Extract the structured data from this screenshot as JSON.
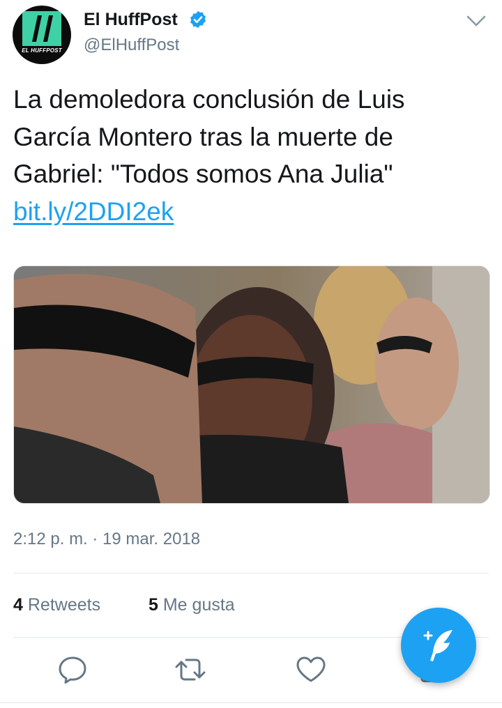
{
  "account": {
    "display_name": "El HuffPost",
    "handle": "@ElHuffPost",
    "avatar_wordmark": "EL HUFFPOST",
    "verified_icon": "verified-badge-icon",
    "menu_icon": "chevron-down-icon"
  },
  "tweet": {
    "text": "La demoledora conclusión de Luis García Montero tras la muerte de Gabriel: \"Todos somos Ana Julia\"",
    "link": "bit.ly/2DDI2ek",
    "media": "photo of three people in a crowd, man in sunglasses in the foreground",
    "timestamp": "2:12 p. m. · 19 mar. 2018"
  },
  "stats": {
    "retweets_count": "4",
    "retweets_label": "Retweets",
    "likes_count": "5",
    "likes_label": "Me gusta"
  },
  "actions": [
    "reply-icon",
    "retweet-icon",
    "like-icon",
    "share-icon"
  ],
  "compose_icon": "compose-tweet-icon",
  "colors": {
    "accent": "#1da1f2",
    "text": "#14171a",
    "secondary": "#657786",
    "divider": "#e1e8ed",
    "avatar_bg": "#0c0c0c",
    "logo_green": "#3ed1a6"
  }
}
